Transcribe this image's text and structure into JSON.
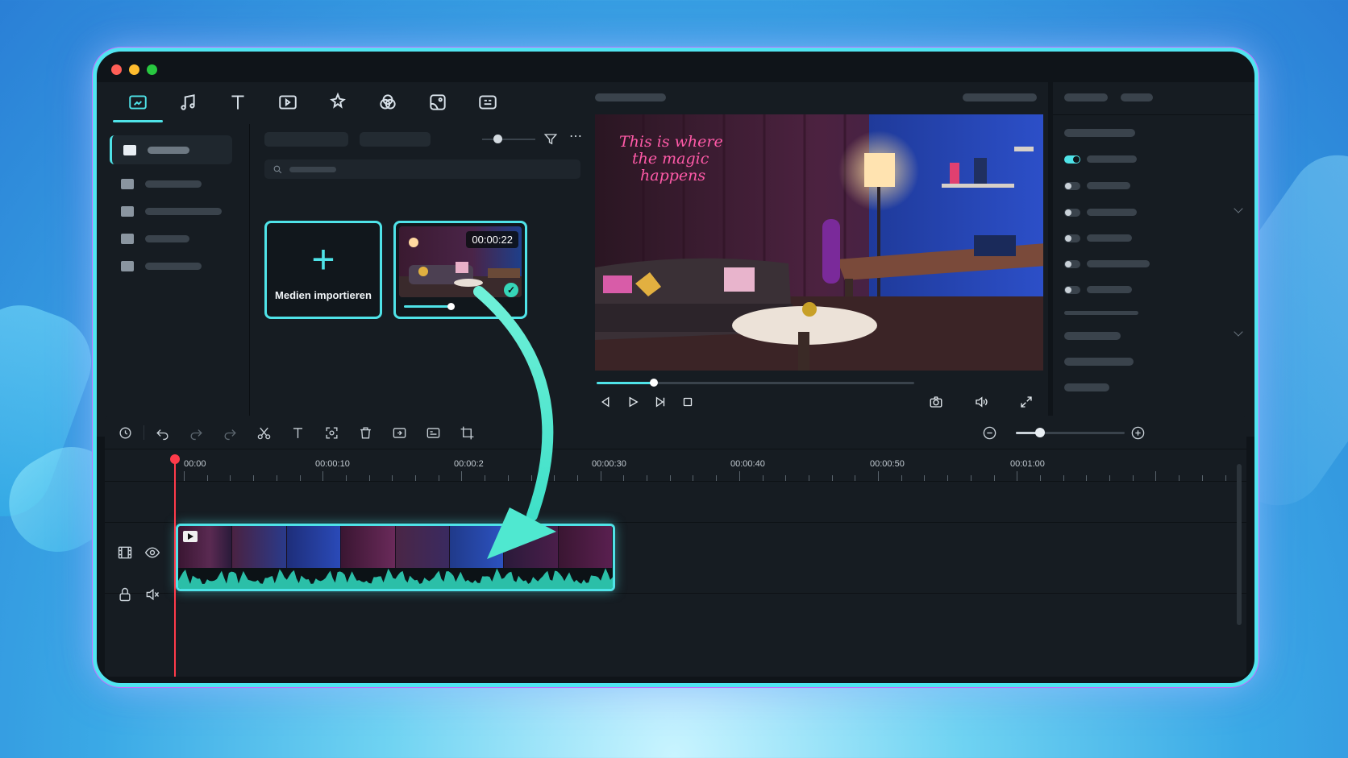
{
  "media": {
    "import_label": "Medien importieren",
    "import_icon": "plus-icon",
    "clip_duration": "00:00:22",
    "clip_progress": 0.45
  },
  "preview": {
    "progress": 0.18
  },
  "timeline": {
    "ticks": [
      "00:00",
      "00:00:10",
      "00:00:2",
      "00:00:30",
      "00:00:40",
      "00:00:50",
      "00:01:00"
    ],
    "zoom_level": 0.22
  },
  "colors": {
    "accent": "#4fe3e8",
    "playhead": "#ff3b4a",
    "window_bg": "#0f1419",
    "panel_bg": "#161c22"
  }
}
